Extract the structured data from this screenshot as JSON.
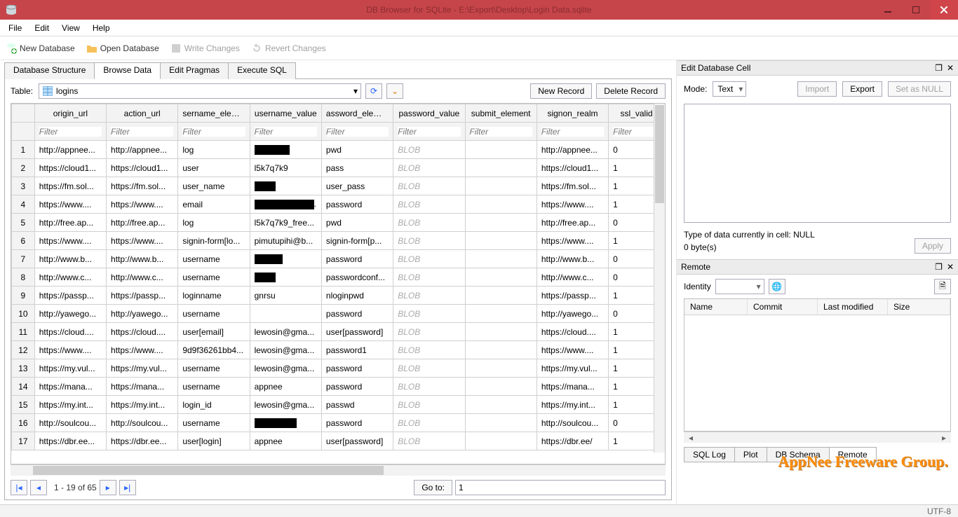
{
  "title": "DB Browser for SQLite - E:\\Export\\Desktop\\Login Data.sqlite",
  "menu": {
    "file": "File",
    "edit": "Edit",
    "view": "View",
    "help": "Help"
  },
  "toolbar": {
    "newdb": "New Database",
    "opendb": "Open Database",
    "writech": "Write Changes",
    "revertch": "Revert Changes"
  },
  "tabs": {
    "structure": "Database Structure",
    "browse": "Browse Data",
    "pragmas": "Edit Pragmas",
    "execsql": "Execute SQL"
  },
  "browse": {
    "table_label": "Table:",
    "table_sel": "logins",
    "new_record": "New Record",
    "delete_record": "Delete Record",
    "columns": [
      "origin_url",
      "action_url",
      "sername_elemen",
      "username_value",
      "assword_elemen",
      "password_value",
      "submit_element",
      "signon_realm",
      "ssl_valid"
    ],
    "filter_placeholder": "Filter",
    "rows": [
      {
        "n": 1,
        "cells": [
          "http://appnee...",
          "http://appnee...",
          "log",
          "[REDACT:50]",
          "pwd",
          "BLOB",
          "",
          "http://appnee...",
          "0"
        ]
      },
      {
        "n": 2,
        "cells": [
          "https://cloud1...",
          "https://cloud1...",
          "user",
          "l5k7q7k9",
          "pass",
          "BLOB",
          "",
          "https://cloud1...",
          "1"
        ]
      },
      {
        "n": 3,
        "cells": [
          "https://fm.sol...",
          "https://fm.sol...",
          "user_name",
          "[REDACT:30]",
          "user_pass",
          "BLOB",
          "",
          "https://fm.sol...",
          "1"
        ]
      },
      {
        "n": 4,
        "cells": [
          "https://www....",
          "https://www....",
          "email",
          "[REDACT:85].",
          "password",
          "BLOB",
          "",
          "https://www....",
          "1"
        ]
      },
      {
        "n": 5,
        "cells": [
          "http://free.ap...",
          "http://free.ap...",
          "log",
          "l5k7q7k9_free...",
          "pwd",
          "BLOB",
          "",
          "http://free.ap...",
          "0"
        ]
      },
      {
        "n": 6,
        "cells": [
          "https://www....",
          "https://www....",
          "signin-form[lo...",
          "pimutupihi@b...",
          "signin-form[p...",
          "BLOB",
          "",
          "https://www....",
          "1"
        ]
      },
      {
        "n": 7,
        "cells": [
          "http://www.b...",
          "http://www.b...",
          "username",
          "[REDACT:40]",
          "password",
          "BLOB",
          "",
          "http://www.b...",
          "0"
        ]
      },
      {
        "n": 8,
        "cells": [
          "http://www.c...",
          "http://www.c...",
          "username",
          "[REDACT:30]",
          "passwordconf...",
          "BLOB",
          "",
          "http://www.c...",
          "0"
        ]
      },
      {
        "n": 9,
        "cells": [
          "https://passp...",
          "https://passp...",
          "loginname",
          "gnrsu",
          "nloginpwd",
          "BLOB",
          "",
          "https://passp...",
          "1"
        ]
      },
      {
        "n": 10,
        "cells": [
          "http://yawego...",
          "http://yawego...",
          "username",
          "",
          "password",
          "BLOB",
          "",
          "http://yawego...",
          "0"
        ]
      },
      {
        "n": 11,
        "cells": [
          "https://cloud....",
          "https://cloud....",
          "user[email]",
          "lewosin@gma...",
          "user[password]",
          "BLOB",
          "",
          "https://cloud....",
          "1"
        ]
      },
      {
        "n": 12,
        "cells": [
          "https://www....",
          "https://www....",
          "9d9f36261bb4...",
          "lewosin@gma...",
          "password1",
          "BLOB",
          "",
          "https://www....",
          "1"
        ]
      },
      {
        "n": 13,
        "cells": [
          "https://my.vul...",
          "https://my.vul...",
          "username",
          "lewosin@gma...",
          "password",
          "BLOB",
          "",
          "https://my.vul...",
          "1"
        ]
      },
      {
        "n": 14,
        "cells": [
          "https://mana...",
          "https://mana...",
          "username",
          "appnee",
          "password",
          "BLOB",
          "",
          "https://mana...",
          "1"
        ]
      },
      {
        "n": 15,
        "cells": [
          "https://my.int...",
          "https://my.int...",
          "login_id",
          "lewosin@gma...",
          "passwd",
          "BLOB",
          "",
          "https://my.int...",
          "1"
        ]
      },
      {
        "n": 16,
        "cells": [
          "http://soulcou...",
          "http://soulcou...",
          "username",
          "[REDACT:60]",
          "password",
          "BLOB",
          "",
          "http://soulcou...",
          "0"
        ]
      },
      {
        "n": 17,
        "cells": [
          "https://dbr.ee...",
          "https://dbr.ee...",
          "user[login]",
          "appnee",
          "user[password]",
          "BLOB",
          "",
          "https://dbr.ee/",
          "1"
        ]
      }
    ],
    "nav_info": "1 - 19 of 65",
    "goto_label": "Go to:",
    "goto_val": "1"
  },
  "editcell": {
    "title": "Edit Database Cell",
    "mode_label": "Mode:",
    "mode_val": "Text",
    "import": "Import",
    "export": "Export",
    "setnull": "Set as NULL",
    "type_line": "Type of data currently in cell: NULL",
    "bytes_line": "0 byte(s)",
    "apply": "Apply"
  },
  "remote": {
    "title": "Remote",
    "identity_label": "Identity",
    "cols": {
      "name": "Name",
      "commit": "Commit",
      "lastmod": "Last modified",
      "size": "Size"
    }
  },
  "bottomtabs": {
    "sqllog": "SQL Log",
    "plot": "Plot",
    "schema": "DB Schema",
    "remote": "Remote"
  },
  "statusbar": {
    "enc": "UTF-8"
  },
  "watermark": "AppNee Freeware Group."
}
